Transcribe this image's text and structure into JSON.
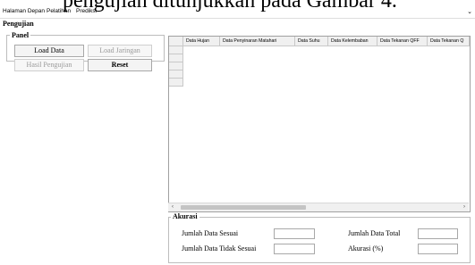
{
  "caption": "pengujian ditunjukkan pada Gambar 4.",
  "menu": {
    "items": [
      "Halaman Depan",
      "Pelatihan",
      "Prediksi"
    ]
  },
  "section_title": "Pengujian",
  "panel": {
    "title": "Panel",
    "load_data": "Load Data",
    "load_jaringan": "Load Jaringan",
    "hasil_pengujian": "Hasil Pengujian",
    "reset": "Reset"
  },
  "table": {
    "columns": [
      "Data Hujan",
      "Data Penyinaran Matahari",
      "Data Suhu",
      "Data Kelembaban",
      "Data Tekanan QFF",
      "Data Tekanan Q"
    ]
  },
  "accuracy": {
    "title": "Akurasi",
    "jumlah_sesuai": "Jumlah Data Sesuai",
    "jumlah_tidak_sesuai": "Jumlah Data Tidak Sesuai",
    "jumlah_total": "Jumlah Data Total",
    "akurasi": "Akurasi (%)"
  }
}
